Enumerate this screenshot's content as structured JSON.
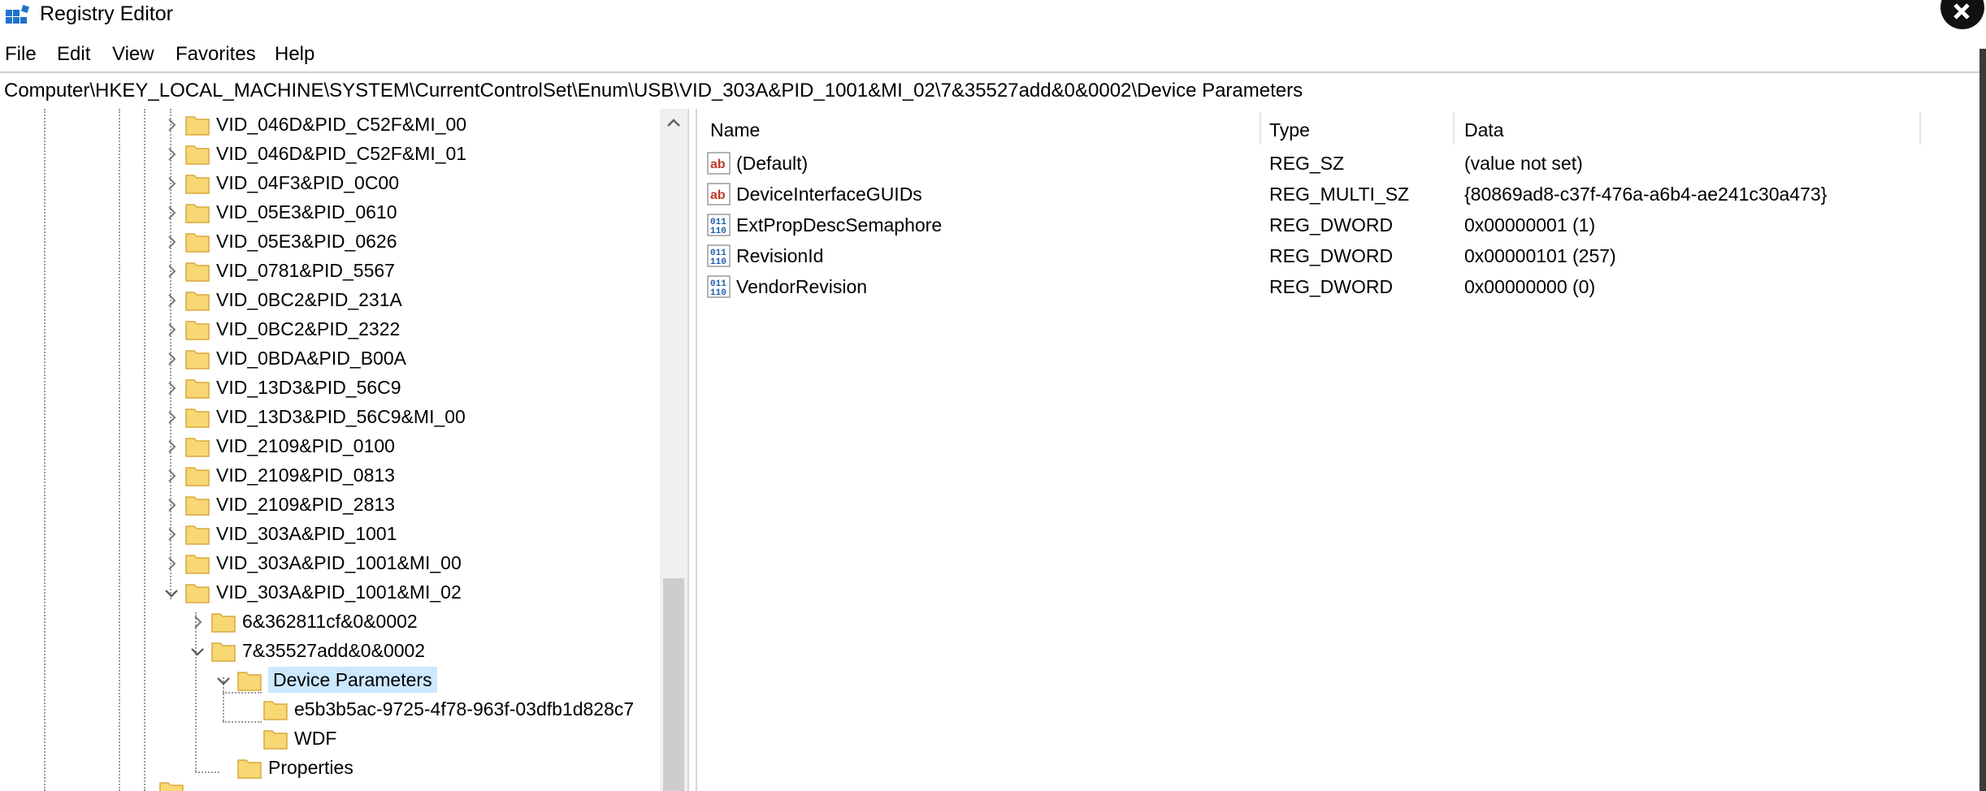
{
  "window": {
    "title": "Registry Editor"
  },
  "menu": [
    "File",
    "Edit",
    "View",
    "Favorites",
    "Help"
  ],
  "address": "Computer\\HKEY_LOCAL_MACHINE\\SYSTEM\\CurrentControlSet\\Enum\\USB\\VID_303A&PID_1001&MI_02\\7&35527add&0&0002\\Device Parameters",
  "tree": {
    "items": [
      "VID_046D&PID_C52F&MI_00",
      "VID_046D&PID_C52F&MI_01",
      "VID_04F3&PID_0C00",
      "VID_05E3&PID_0610",
      "VID_05E3&PID_0626",
      "VID_0781&PID_5567",
      "VID_0BC2&PID_231A",
      "VID_0BC2&PID_2322",
      "VID_0BDA&PID_B00A",
      "VID_13D3&PID_56C9",
      "VID_13D3&PID_56C9&MI_00",
      "VID_2109&PID_0100",
      "VID_2109&PID_0813",
      "VID_2109&PID_2813",
      "VID_303A&PID_1001",
      "VID_303A&PID_1001&MI_00",
      "VID_303A&PID_1001&MI_02"
    ],
    "child1": "6&362811cf&0&0002",
    "child2": "7&35527add&0&0002",
    "selected": "Device Parameters",
    "grandchild1": "e5b3b5ac-9725-4f78-963f-03dfb1d828c7",
    "grandchild2": "WDF",
    "properties": "Properties"
  },
  "list": {
    "headers": {
      "name": "Name",
      "type": "Type",
      "data": "Data"
    },
    "rows": [
      {
        "icon": "string-value-icon",
        "name": "(Default)",
        "type": "REG_SZ",
        "data": "(value not set)"
      },
      {
        "icon": "string-value-icon",
        "name": "DeviceInterfaceGUIDs",
        "type": "REG_MULTI_SZ",
        "data": "{80869ad8-c37f-476a-a6b4-ae241c30a473}"
      },
      {
        "icon": "binary-value-icon",
        "name": "ExtPropDescSemaphore",
        "type": "REG_DWORD",
        "data": "0x00000001 (1)"
      },
      {
        "icon": "binary-value-icon",
        "name": "RevisionId",
        "type": "REG_DWORD",
        "data": "0x00000101 (257)"
      },
      {
        "icon": "binary-value-icon",
        "name": "VendorRevision",
        "type": "REG_DWORD",
        "data": "0x00000000 (0)"
      }
    ]
  },
  "colors": {
    "folder": "#f8d775",
    "folder_edge": "#d9a93a",
    "selection": "#cce8ff",
    "string_icon": "#c0392b",
    "binary_icon": "#1f5fa8"
  }
}
